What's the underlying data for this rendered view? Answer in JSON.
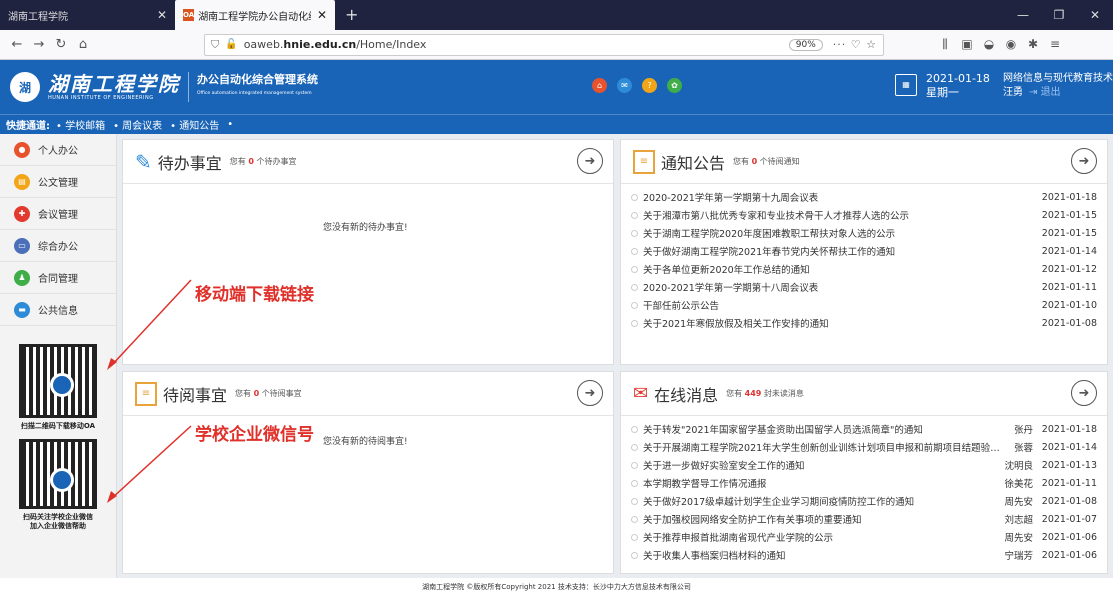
{
  "browser": {
    "tabs": [
      {
        "label": "湖南工程学院"
      },
      {
        "label": "湖南工程学院办公自动化综合管",
        "favicon": "OA"
      }
    ],
    "new_tab": "+",
    "url_prefix": "oaweb.",
    "url_host": "hnie.edu.cn",
    "url_path": "/Home/Index",
    "zoom": "90%",
    "page_actions": "··· ♡ ☆"
  },
  "header": {
    "logo_mark": "湖",
    "school_name": "湖南工程学院",
    "school_name_en": "HUNAN INSTITUTE OF ENGINEERING",
    "system_name": "办公自动化综合管理系统",
    "system_name_en": "Office automation integrated management system",
    "date": "2021-01-18",
    "weekday": "星期一",
    "department": "网络信息与现代教育技术中",
    "user": "汪勇",
    "logout": "退出",
    "colors": {
      "brand": "#1a64b7"
    }
  },
  "quickbar": {
    "label": "快捷通道:",
    "links": [
      "• 学校邮箱",
      "• 周会议表",
      "• 通知公告",
      "•"
    ]
  },
  "sidebar": {
    "items": [
      {
        "label": "个人办公",
        "color": "#e8532e"
      },
      {
        "label": "公文管理",
        "color": "#f2a516"
      },
      {
        "label": "会议管理",
        "color": "#e23a2e"
      },
      {
        "label": "综合办公",
        "color": "#4b6fb8"
      },
      {
        "label": "合同管理",
        "color": "#3fae49"
      },
      {
        "label": "公共信息",
        "color": "#2d8bd8"
      }
    ],
    "qr1_caption": "扫描二维码下载移动OA",
    "qr2_caption_1": "扫码关注学校企业微信",
    "qr2_caption_2": "加入企业微信帮助"
  },
  "todo": {
    "title": "待办事宜",
    "sub_pre": "您有",
    "count": "0",
    "sub_post": "个待办事宜",
    "empty": "您没有新的待办事宜!"
  },
  "toread": {
    "title": "待阅事宜",
    "sub_pre": "您有",
    "count": "0",
    "sub_post": "个待阅事宜",
    "empty": "您没有新的待阅事宜!"
  },
  "notices": {
    "title": "通知公告",
    "sub_pre": "您有",
    "count": "0",
    "sub_post": "个待阅通知",
    "rows": [
      {
        "title": "2020-2021学年第一学期第十九周会议表",
        "date": "2021-01-18"
      },
      {
        "title": "关于湘潭市第八批优秀专家和专业技术骨干人才推荐人选的公示",
        "date": "2021-01-15"
      },
      {
        "title": "关于湖南工程学院2020年度困难教职工帮扶对象人选的公示",
        "date": "2021-01-15"
      },
      {
        "title": "关于做好湖南工程学院2021年春节党内关怀帮扶工作的通知",
        "date": "2021-01-14"
      },
      {
        "title": "关于各单位更新2020年工作总结的通知",
        "date": "2021-01-12"
      },
      {
        "title": "2020-2021学年第一学期第十八周会议表",
        "date": "2021-01-11"
      },
      {
        "title": "干部任前公示公告",
        "date": "2021-01-10"
      },
      {
        "title": "关于2021年寒假放假及相关工作安排的通知",
        "date": "2021-01-08"
      }
    ]
  },
  "messages": {
    "title": "在线消息",
    "sub_pre": "您有",
    "count": "449",
    "sub_post": "封未读消息",
    "rows": [
      {
        "title": "关于转发\"2021年国家留学基金资助出国留学人员选派简章\"的通知",
        "author": "张丹",
        "date": "2021-01-18"
      },
      {
        "title": "关于开展湖南工程学院2021年大学生创新创业训练计划项目申报和前期项目结题验收工作...",
        "author": "张蓉",
        "date": "2021-01-14"
      },
      {
        "title": "关于进一步做好实验室安全工作的通知",
        "author": "沈明良",
        "date": "2021-01-13"
      },
      {
        "title": "本学期教学督导工作情况通报",
        "author": "徐美花",
        "date": "2021-01-11"
      },
      {
        "title": "关于做好2017级卓越计划学生企业学习期间疫情防控工作的通知",
        "author": "周先安",
        "date": "2021-01-08"
      },
      {
        "title": "关于加强校园网络安全防护工作有关事项的重要通知",
        "author": "刘志超",
        "date": "2021-01-07"
      },
      {
        "title": "关于推荐申报首批湖南省现代产业学院的公示",
        "author": "周先安",
        "date": "2021-01-06"
      },
      {
        "title": "关于收集人事档案归档材料的通知",
        "author": "宁瑞芳",
        "date": "2021-01-06"
      }
    ]
  },
  "annotations": {
    "mobile": "移动端下载链接",
    "wechat": "学校企业微信号"
  },
  "footer": "湖南工程学院 ©版权所有Copyright 2021 技术支持：长沙中力大方信息技术有限公司"
}
